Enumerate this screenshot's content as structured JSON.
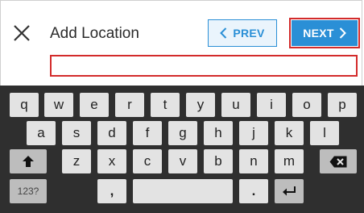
{
  "header": {
    "title": "Add Location",
    "prev_label": "PREV",
    "next_label": "NEXT"
  },
  "location_input": {
    "value": "",
    "placeholder": ""
  },
  "keyboard": {
    "row1": [
      "q",
      "w",
      "e",
      "r",
      "t",
      "y",
      "u",
      "i",
      "o",
      "p"
    ],
    "row2": [
      "a",
      "s",
      "d",
      "f",
      "g",
      "h",
      "j",
      "k",
      "l"
    ],
    "row3": [
      "z",
      "x",
      "c",
      "v",
      "b",
      "n",
      "m"
    ],
    "row4": {
      "mode_label": "123?",
      "comma": ",",
      "period": "."
    }
  },
  "colors": {
    "accent": "#2a8fd6",
    "highlight_red": "#d32b2b",
    "keyboard_bg": "#2f2f2f",
    "key_bg": "#e3e3e3",
    "fn_key_bg": "#bdbdbd"
  },
  "icons": [
    "close-icon",
    "chevron-left-icon",
    "chevron-right-icon",
    "shift-icon",
    "backspace-icon",
    "enter-icon"
  ]
}
